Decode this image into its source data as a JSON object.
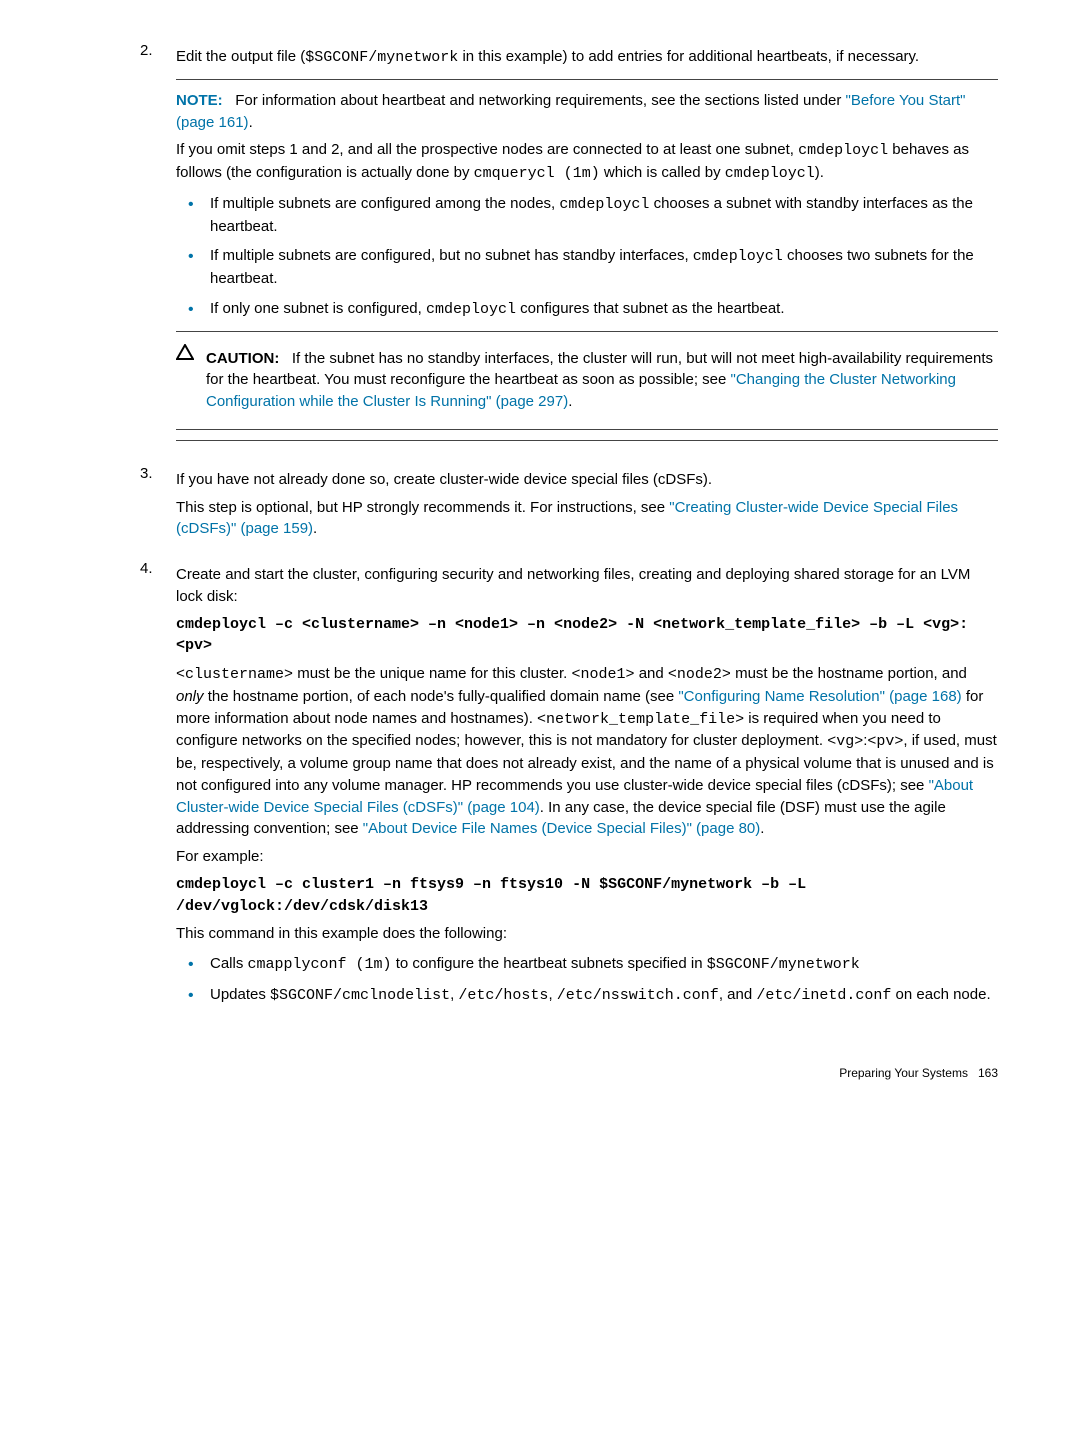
{
  "list": {
    "item2": {
      "num": "2.",
      "intro_a": "Edit the output file (",
      "intro_code": "$SGCONF/mynetwork",
      "intro_b": " in this example) to add entries for additional heartbeats, if necessary.",
      "note": {
        "label": "NOTE:",
        "text_a": "For information about heartbeat and networking requirements, see the sections listed under ",
        "link": "\"Before You Start\" (page 161)",
        "text_b": "."
      },
      "omit_a": "If you omit steps 1 and 2, and all the prospective nodes are connected to at least one subnet, ",
      "omit_code1": "cmdeploycl",
      "omit_b": " behaves as follows (the configuration is actually done by ",
      "omit_code2": "cmquerycl (1m)",
      "omit_c": " which is called by ",
      "omit_code3": "cmdeploycl",
      "omit_d": ").",
      "bullets": {
        "b1_a": "If multiple subnets are configured among the nodes, ",
        "b1_code": "cmdeploycl",
        "b1_b": " chooses a subnet with standby interfaces as the heartbeat.",
        "b2_a": "If multiple subnets are configured, but no subnet has standby interfaces, ",
        "b2_code": "cmdeploycl",
        "b2_b": " chooses two subnets for the heartbeat.",
        "b3_a": "If only one subnet is configured, ",
        "b3_code": "cmdeploycl",
        "b3_b": " configures that subnet as the heartbeat."
      },
      "caution": {
        "label": "CAUTION:",
        "text_a": "If the subnet has no standby interfaces, the cluster will run, but will not meet high-availability requirements for the heartbeat. You must reconfigure the heartbeat as soon as possible; see ",
        "link": "\"Changing the Cluster Networking Configuration while the Cluster Is Running\" (page 297)",
        "text_b": "."
      }
    },
    "item3": {
      "num": "3.",
      "line1": "If you have not already done so, create cluster-wide device special files (cDSFs).",
      "line2_a": "This step is optional, but HP strongly recommends it. For instructions, see ",
      "line2_link": "\"Creating Cluster-wide Device Special Files (cDSFs)\" (page 159)",
      "line2_b": "."
    },
    "item4": {
      "num": "4.",
      "line1": "Create and start the cluster, configuring security and networking files, creating and deploying shared storage for an LVM lock disk:",
      "cmd1": "cmdeploycl –c <clustername> –n <node1> –n <node2> -N <network_template_file> –b –L <vg>:<pv>",
      "para1": {
        "p1": "<clustername>",
        "p2": " must be the unique name for this cluster. ",
        "p3": "<node1>",
        "p4": " and ",
        "p5": "<node2>",
        "p6": " must be the hostname portion, and ",
        "p6i": "only",
        "p7": " the hostname portion, of each node's fully-qualified domain name (see ",
        "link1": "\"Configuring Name Resolution\" (page 168)",
        "p8": " for more information about node names and hostnames). ",
        "p9": "<network_template_file>",
        "p10": " is required when you need to configure networks on the specified nodes; however, this is not mandatory for cluster deployment. ",
        "p11": "<vg>",
        "p12": ":",
        "p13": "<pv>",
        "p14": ", if used, must be, respectively, a volume group name that does not already exist, and the name of a physical volume that is unused and is not configured into any volume manager. HP recommends you use cluster-wide device special files (cDSFs); see ",
        "link2": "\"About Cluster-wide Device Special Files (cDSFs)\" (page 104)",
        "p15": ". In any case, the device special file (DSF) must use the agile addressing convention; see ",
        "link3": "\"About Device File Names (Device Special Files)\" (page 80)",
        "p16": "."
      },
      "forex": "For example:",
      "cmd2": "cmdeploycl –c cluster1 –n ftsys9 –n ftsys10 -N $SGCONF/mynetwork –b –L /dev/vglock:/dev/cdsk/disk13",
      "cmddesc": "This command in this example does the following:",
      "bullets": {
        "b1_a": "Calls ",
        "b1_code1": "cmapplyconf (1m)",
        "b1_b": " to configure the heartbeat subnets specified in ",
        "b1_code2": "$SGCONF/mynetwork",
        "b2_a": "Updates ",
        "b2_code1": "$SGCONF/cmclnodelist",
        "b2_b": ", ",
        "b2_code2": "/etc/hosts",
        "b2_c": ", ",
        "b2_code3": "/etc/nsswitch.conf",
        "b2_d": ", and ",
        "b2_code4": "/etc/inetd.conf",
        "b2_e": " on each node."
      }
    }
  },
  "footer": {
    "section": "Preparing Your Systems",
    "page": "163"
  }
}
